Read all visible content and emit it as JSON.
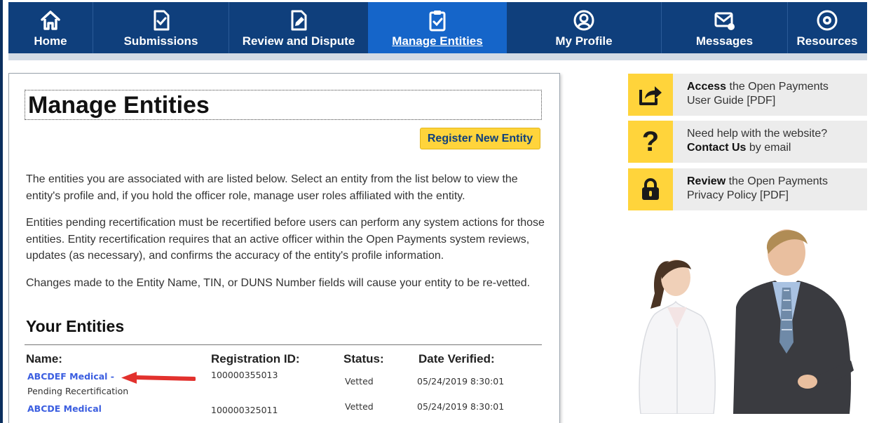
{
  "nav": {
    "items": [
      {
        "label": "Home",
        "icon": "home-icon"
      },
      {
        "label": "Submissions",
        "icon": "submissions-icon"
      },
      {
        "label": "Review and Dispute",
        "icon": "review-icon"
      },
      {
        "label": "Manage Entities",
        "icon": "clipboard-check-icon",
        "active": true
      },
      {
        "label": "My Profile",
        "icon": "profile-icon"
      },
      {
        "label": "Messages",
        "icon": "messages-icon"
      },
      {
        "label": "Resources",
        "icon": "resources-icon"
      }
    ]
  },
  "main": {
    "title": "Manage Entities",
    "register_button": "Register New Entity",
    "paragraphs": [
      "The entities you are associated with are listed below. Select an entity from the list below to view the entity's profile and, if you hold the officer role, manage user roles affiliated with the entity.",
      "Entities pending recertification must be recertified before users can perform any system actions for those entities. Entity recertification requires that an active officer within the Open Payments system reviews, updates (as necessary), and confirms the accuracy of the entity's profile information.",
      "Changes made to the Entity Name, TIN, or DUNS Number fields will cause your entity to be re-vetted."
    ],
    "entities_title": "Your Entities",
    "table": {
      "headers": [
        "Name:",
        "Registration ID:",
        "Status:",
        "Date Verified:"
      ],
      "rows": [
        {
          "name": "ABCDEF Medical -",
          "note": "Pending Recertification",
          "registration_id": "100000355013",
          "status": "Vetted",
          "date_verified": "05/24/2019 8:30:01"
        },
        {
          "name": "ABCDE Medical",
          "note": "",
          "registration_id": "100000325011",
          "status": "Vetted",
          "date_verified": "05/24/2019 8:30:01"
        }
      ]
    }
  },
  "sidebar": {
    "boxes": [
      {
        "icon": "share-arrow-icon",
        "bold": "Access",
        "line1_rest": " the Open Payments",
        "line2": "User Guide [PDF]"
      },
      {
        "icon": "question-icon",
        "line1": "Need help with the website?",
        "bold": "Contact Us",
        "line2_rest": " by email"
      },
      {
        "icon": "lock-icon",
        "bold": "Review",
        "line1_rest": " the Open Payments",
        "line2": "Privacy Policy [PDF]"
      }
    ]
  },
  "colors": {
    "nav_bg": "#0f3f7c",
    "nav_active": "#1565c9",
    "accent_yellow": "#ffd43b",
    "link_blue": "#3b5ee0",
    "arrow_red": "#e2312d"
  }
}
